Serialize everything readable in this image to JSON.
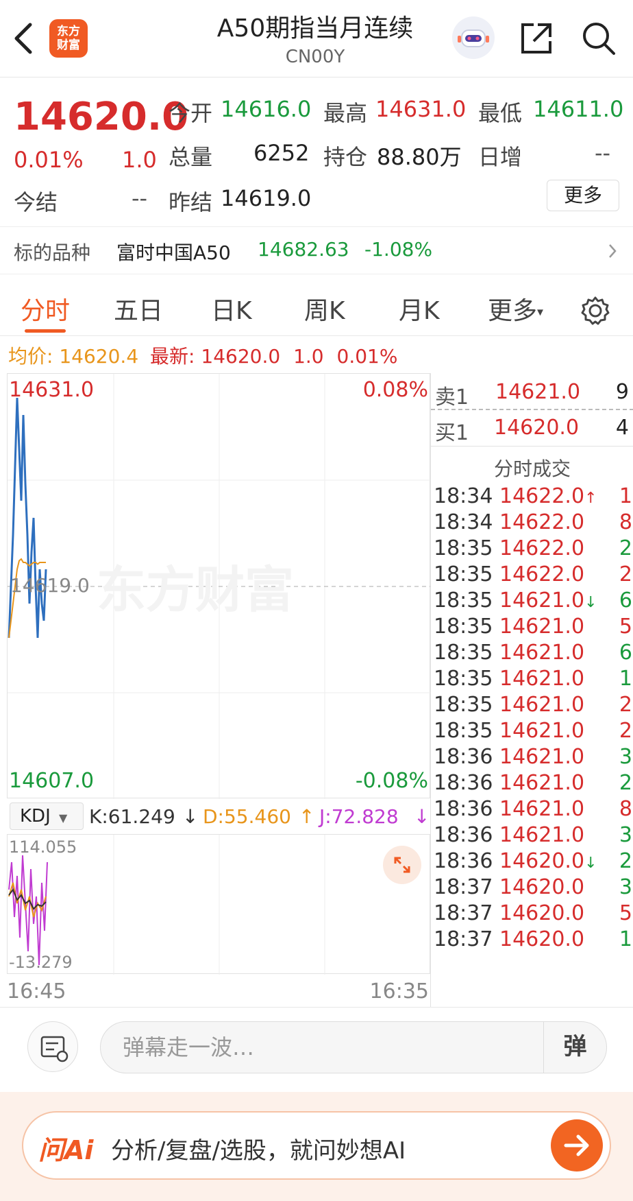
{
  "header": {
    "title": "A50期指当月连续",
    "subtitle": "CN00Y",
    "logo_text_1": "东方",
    "logo_text_2": "财富"
  },
  "quote": {
    "last": "14620.0",
    "change_pct": "0.01%",
    "change": "1.0",
    "settle_label": "今结",
    "settle_value": "--",
    "open_label": "今开",
    "open_value": "14616.0",
    "high_label": "最高",
    "high_value": "14631.0",
    "low_label": "最低",
    "low_value": "14611.0",
    "volume_label": "总量",
    "volume_value": "6252",
    "oi_label": "持仓",
    "oi_value": "88.80万",
    "daily_inc_label": "日增",
    "daily_inc_value": "--",
    "prev_settle_label": "昨结",
    "prev_settle_value": "14619.0",
    "more_label": "更多"
  },
  "underlying": {
    "label": "标的品种",
    "name": "富时中国A50",
    "price": "14682.63",
    "change_pct": "-1.08%"
  },
  "tabs": [
    "分时",
    "五日",
    "日K",
    "周K",
    "月K",
    "更多"
  ],
  "avg_line": {
    "avg_label": "均价:",
    "avg_value": "14620.4",
    "latest_label": "最新:",
    "latest_value": "14620.0",
    "change": "1.0",
    "change_pct": "0.01%"
  },
  "chart_labels": {
    "top_price": "14631.0",
    "top_pct": "0.08%",
    "mid_price": "14619.0",
    "bottom_price": "14607.0",
    "bottom_pct": "-0.08%",
    "watermark": "东方财富",
    "time_start": "16:45",
    "time_end": "16:35"
  },
  "kdj": {
    "selector": "KDJ",
    "k": "K:61.249",
    "d": "D:55.460",
    "j": "J:72.828",
    "top": "114.055",
    "bottom": "-13.279"
  },
  "orderbook": {
    "sell_label": "卖1",
    "sell_price": "14621.0",
    "sell_vol": "9",
    "buy_label": "买1",
    "buy_price": "14620.0",
    "buy_vol": "4",
    "ticks_title": "分时成交"
  },
  "ticks": [
    {
      "time": "18:34",
      "price": "14622.0",
      "arrow": "↑",
      "vol": "1",
      "vcolor": "red"
    },
    {
      "time": "18:34",
      "price": "14622.0",
      "arrow": "",
      "vol": "8",
      "vcolor": "red"
    },
    {
      "time": "18:35",
      "price": "14622.0",
      "arrow": "",
      "vol": "2",
      "vcolor": "green"
    },
    {
      "time": "18:35",
      "price": "14622.0",
      "arrow": "",
      "vol": "2",
      "vcolor": "red"
    },
    {
      "time": "18:35",
      "price": "14621.0",
      "arrow": "↓",
      "vol": "6",
      "vcolor": "green"
    },
    {
      "time": "18:35",
      "price": "14621.0",
      "arrow": "",
      "vol": "5",
      "vcolor": "red"
    },
    {
      "time": "18:35",
      "price": "14621.0",
      "arrow": "",
      "vol": "6",
      "vcolor": "green"
    },
    {
      "time": "18:35",
      "price": "14621.0",
      "arrow": "",
      "vol": "1",
      "vcolor": "green"
    },
    {
      "time": "18:35",
      "price": "14621.0",
      "arrow": "",
      "vol": "2",
      "vcolor": "red"
    },
    {
      "time": "18:35",
      "price": "14621.0",
      "arrow": "",
      "vol": "2",
      "vcolor": "red"
    },
    {
      "time": "18:36",
      "price": "14621.0",
      "arrow": "",
      "vol": "3",
      "vcolor": "green"
    },
    {
      "time": "18:36",
      "price": "14621.0",
      "arrow": "",
      "vol": "2",
      "vcolor": "green"
    },
    {
      "time": "18:36",
      "price": "14621.0",
      "arrow": "",
      "vol": "8",
      "vcolor": "red"
    },
    {
      "time": "18:36",
      "price": "14621.0",
      "arrow": "",
      "vol": "3",
      "vcolor": "green"
    },
    {
      "time": "18:36",
      "price": "14620.0",
      "arrow": "↓",
      "vol": "2",
      "vcolor": "green"
    },
    {
      "time": "18:37",
      "price": "14620.0",
      "arrow": "",
      "vol": "3",
      "vcolor": "green"
    },
    {
      "time": "18:37",
      "price": "14620.0",
      "arrow": "",
      "vol": "5",
      "vcolor": "red"
    },
    {
      "time": "18:37",
      "price": "14620.0",
      "arrow": "",
      "vol": "1",
      "vcolor": "green"
    }
  ],
  "danmu": {
    "placeholder": "弹幕走一波…",
    "button": "弹"
  },
  "ai": {
    "logo": "问Ai",
    "text": "分析/复盘/选股，就问妙想AI"
  },
  "colors": {
    "up": "#d62c2c",
    "down": "#1a9a3c",
    "accent": "#f05a23",
    "price_line": "#2e6fbe",
    "avg_line": "#e8951b"
  },
  "chart_data": {
    "type": "line",
    "ylim": [
      14607.0,
      14631.0
    ],
    "series": [
      {
        "values": [
          14616,
          14619,
          14622,
          14626,
          14630,
          14627,
          14624,
          14629,
          14625,
          14622,
          14618,
          14621,
          14623,
          14619,
          14616,
          14620,
          14618,
          14617,
          14620
        ]
      },
      {
        "values": [
          14616,
          14617,
          14618,
          14619,
          14620,
          14620.5,
          14620.6,
          14620.4,
          14620.4,
          14620.3,
          14620.2,
          14620.3,
          14620.4,
          14620.4,
          14620.3,
          14620.4,
          14620.4,
          14620.4,
          14620.4
        ]
      }
    ]
  }
}
